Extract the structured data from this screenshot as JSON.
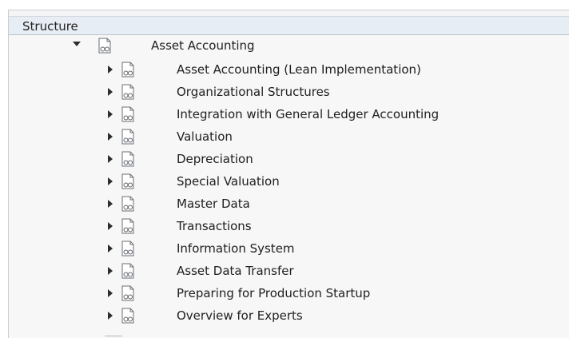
{
  "header": {
    "title": "Structure"
  },
  "tree": {
    "root": {
      "label": "Asset Accounting",
      "expanded": true,
      "icon": "document-glasses-icon"
    },
    "children": [
      {
        "label": "Asset Accounting (Lean Implementation)",
        "expanded": false,
        "icon": "document-glasses-icon"
      },
      {
        "label": "Organizational Structures",
        "expanded": false,
        "icon": "document-glasses-icon"
      },
      {
        "label": "Integration with General Ledger Accounting",
        "expanded": false,
        "icon": "document-glasses-icon"
      },
      {
        "label": "Valuation",
        "expanded": false,
        "icon": "document-glasses-icon"
      },
      {
        "label": "Depreciation",
        "expanded": false,
        "icon": "document-glasses-icon"
      },
      {
        "label": "Special Valuation",
        "expanded": false,
        "icon": "document-glasses-icon"
      },
      {
        "label": "Master Data",
        "expanded": false,
        "icon": "document-glasses-icon"
      },
      {
        "label": "Transactions",
        "expanded": false,
        "icon": "document-glasses-icon"
      },
      {
        "label": "Information System",
        "expanded": false,
        "icon": "document-glasses-icon"
      },
      {
        "label": "Asset Data Transfer",
        "expanded": false,
        "icon": "document-glasses-icon"
      },
      {
        "label": "Preparing for Production Startup",
        "expanded": false,
        "icon": "document-glasses-icon"
      },
      {
        "label": "Overview for Experts",
        "expanded": false,
        "icon": "document-glasses-icon"
      }
    ]
  }
}
